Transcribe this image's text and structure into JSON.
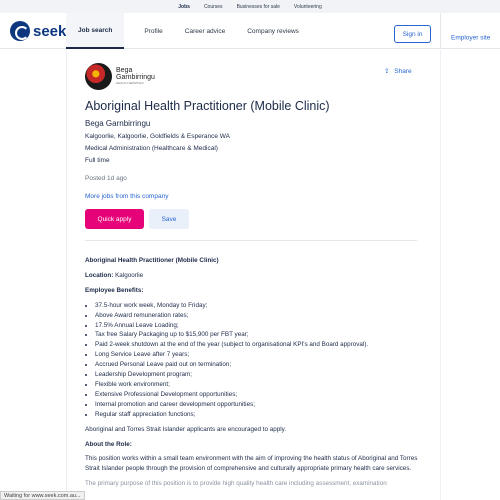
{
  "topbar": {
    "items": [
      "Jobs",
      "Courses",
      "Businesses for sale",
      "Volunteering"
    ]
  },
  "nav": {
    "logo_text": "seek",
    "items": [
      "Job search",
      "Profile",
      "Career advice",
      "Company reviews"
    ],
    "signin": "Sign in",
    "employer_site": "Employer site"
  },
  "job": {
    "company_logo_line1": "Bega",
    "company_logo_line2": "Garnbirringu",
    "company_logo_line3": "HEALTH SERVICES",
    "share": "Share",
    "title": "Aboriginal Health Practitioner (Mobile Clinic)",
    "employer": "Bega Garnbirringu",
    "location": "Kalgoorlie, Kalgoorlie, Goldfields & Esperance WA",
    "category": "Medical Administration (Healthcare & Medical)",
    "work_type": "Full time",
    "posted": "Posted 1d ago",
    "more_jobs": "More jobs from this company",
    "apply": "Quick apply",
    "save": "Save"
  },
  "description": {
    "heading": "Aboriginal Health Practitioner (Mobile Clinic)",
    "location_label": "Location:",
    "location_value": " Kalgoorlie",
    "benefits_heading": "Employee Benefits:",
    "benefits": [
      "37.5-hour work week, Monday to Friday;",
      "Above Award remuneration rates;",
      "17.5% Annual Leave Loading;",
      "Tax free Salary Packaging up to $15,900 per FBT year;",
      "Paid 2-week shutdown at the end of the year (subject to organisational KPI's and Board approval).",
      "Long Service Leave after 7 years;",
      "Accrued Personal Leave paid out on termination;",
      "Leadership Development program;",
      "Flexible work environment;",
      "Extensive Professional Development opportunities;",
      "Internal promotion and career development opportunities;",
      "Regular staff appreciation functions;"
    ],
    "encouraged": "Aboriginal and Torres Strait Islander applicants are encouraged to apply.",
    "about_heading": "About the Role:",
    "about_text": "This position works within a small team environment with the aim of improving the health status of Aboriginal and Torres Strait Islander people through the provision of comprehensive and culturally appropriate primary health care services.",
    "partial_text": "The primary purpose of this position is to provide high quality health care including assessment, examination"
  },
  "status_bar": "Waiting for www.seek.com.au..."
}
